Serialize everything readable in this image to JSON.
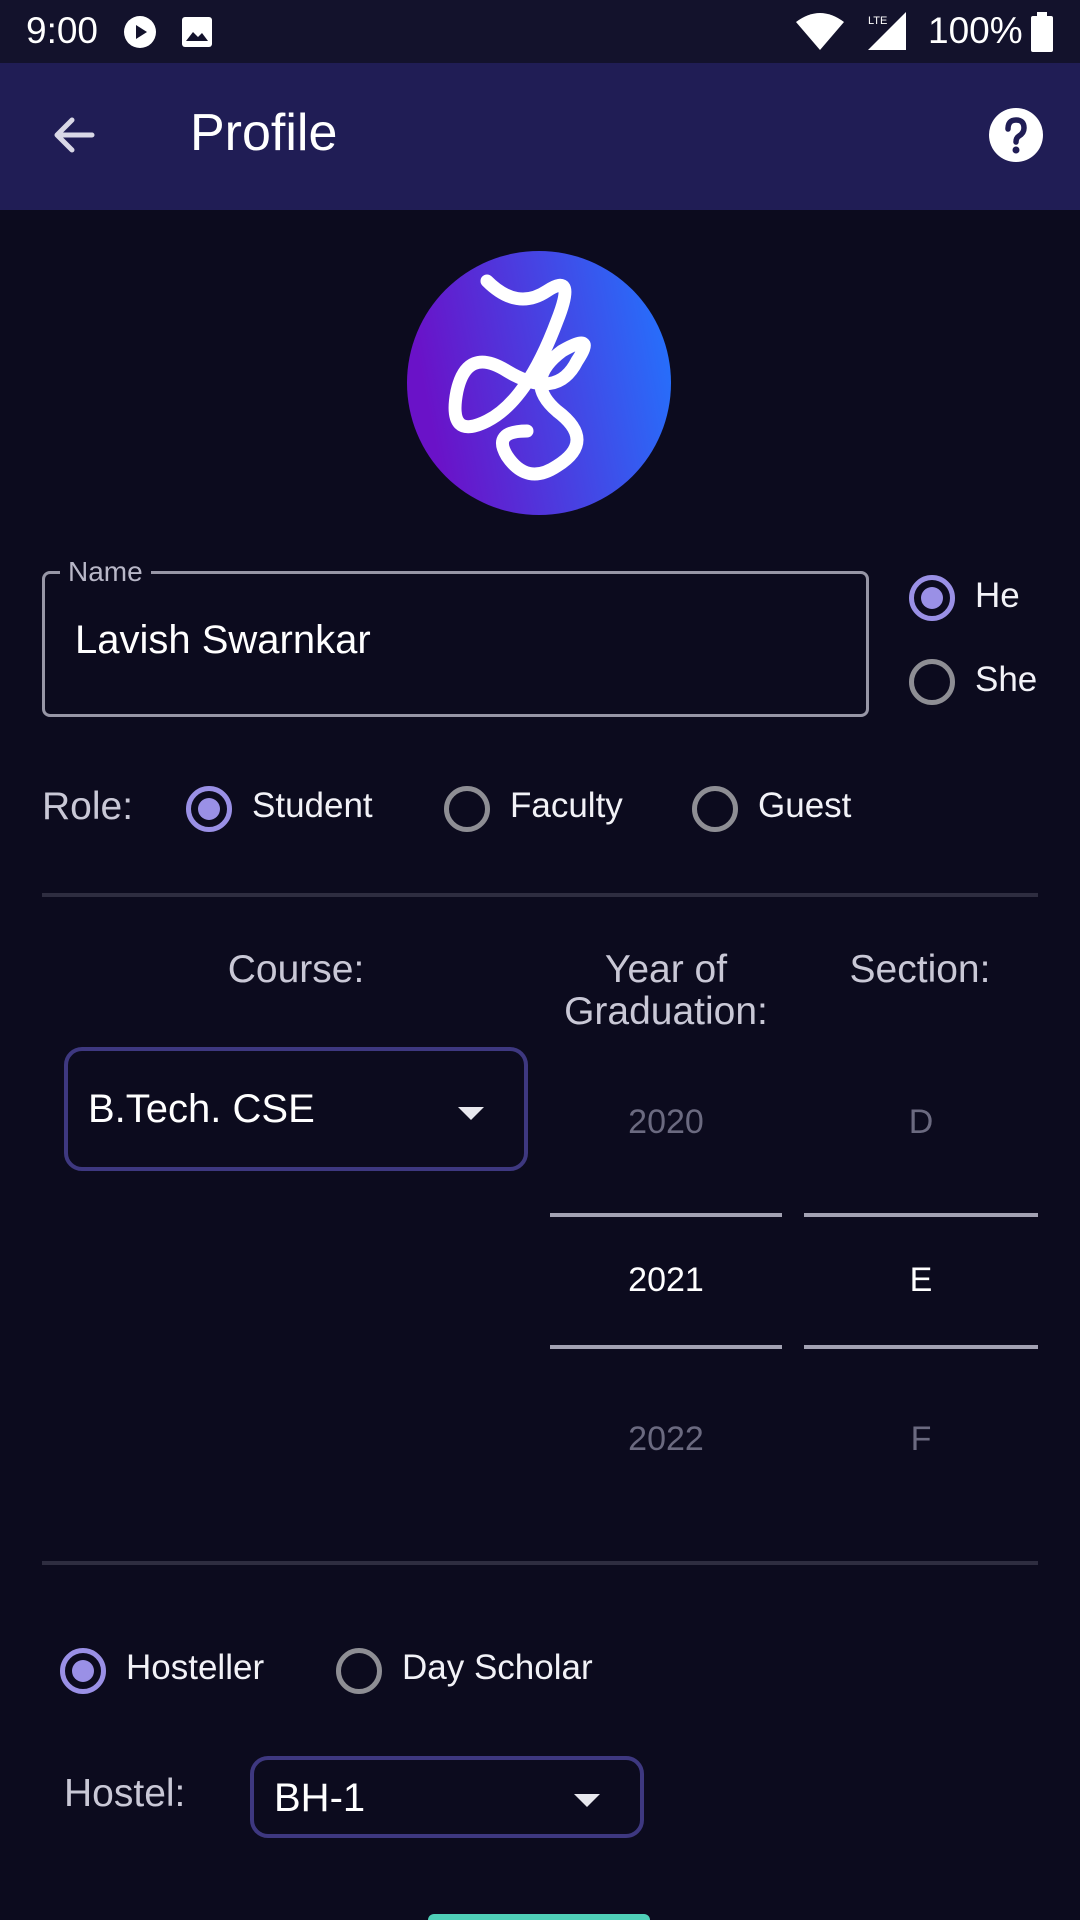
{
  "status_bar": {
    "time": "9:00",
    "battery": "100%"
  },
  "app_bar": {
    "title": "Profile"
  },
  "avatar": {
    "monogram": "LS"
  },
  "name_field": {
    "label": "Name",
    "value": "Lavish Swarnkar"
  },
  "pronouns": [
    {
      "label": "He",
      "checked": true
    },
    {
      "label": "She",
      "checked": false
    }
  ],
  "role": {
    "label": "Role:",
    "options": [
      {
        "label": "Student",
        "checked": true
      },
      {
        "label": "Faculty",
        "checked": false
      },
      {
        "label": "Guest",
        "checked": false
      }
    ]
  },
  "academic": {
    "course_label": "Course:",
    "course_value": "B.Tech. CSE",
    "year_label_1": "Year of",
    "year_label_2": "Graduation:",
    "section_label": "Section:",
    "years": [
      "2020",
      "2021",
      "2022"
    ],
    "sections": [
      "D",
      "E",
      "F"
    ]
  },
  "residence": {
    "options": [
      {
        "label": "Hosteller",
        "checked": true
      },
      {
        "label": "Day Scholar",
        "checked": false
      }
    ],
    "hostel_label": "Hostel:",
    "hostel_value": "BH-1"
  },
  "colors": {
    "accent": "#9a90e6",
    "app_bar": "#201d55",
    "background": "#0c0b1e",
    "dropdown_border": "#3e3880"
  }
}
